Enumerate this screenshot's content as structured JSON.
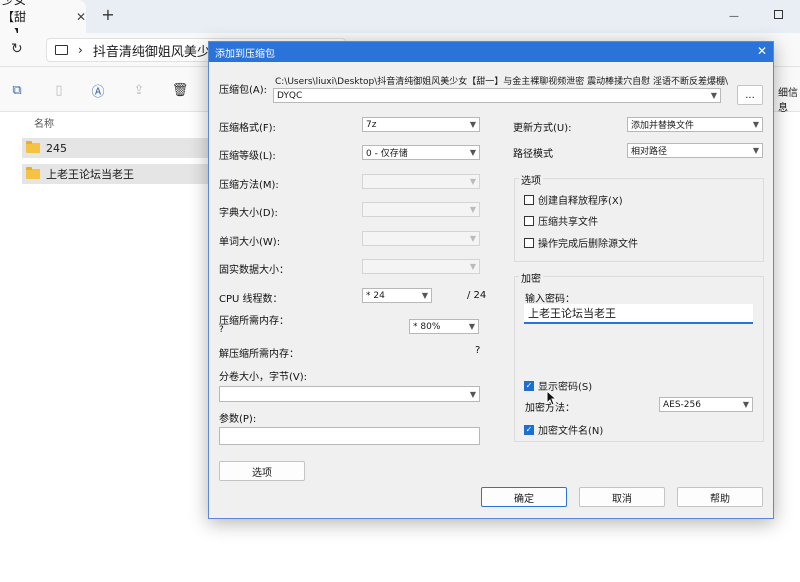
{
  "explorer": {
    "tab_title": "少女【甜一】",
    "path_text": "抖音清纯御姐风美少",
    "column_name": "名称",
    "right_edge_text": "细信息",
    "rows": [
      {
        "name": "245"
      },
      {
        "name": "上老王论坛当老王"
      }
    ]
  },
  "dialog": {
    "title": "添加到压缩包",
    "archive": {
      "label": "压缩包(A):",
      "path": "C:\\Users\\liuxi\\Desktop\\抖音清纯御姐风美少女【甜一】与金主裸聊视频泄密 震动棒揉穴自慰 淫语不断反差爆棚\\",
      "name": "DYQC",
      "browse_label": "..."
    },
    "left": {
      "format_label": "压缩格式(F):",
      "format_value": "7z",
      "level_label": "压缩等级(L):",
      "level_value": "0 - 仅存储",
      "method_label": "压缩方法(M):",
      "dict_label": "字典大小(D):",
      "word_label": "单词大小(W):",
      "solid_label": "固实数据大小：",
      "threads_label": "CPU 线程数：",
      "threads_value": "* 24",
      "threads_total": "/ 24",
      "mem_label": "压缩所需内存：",
      "mem_value": "* 80%",
      "mem_q": "?",
      "decomp_label": "解压缩所需内存：",
      "decomp_q": "?",
      "split_label": "分卷大小，字节(V):",
      "params_label": "参数(P):",
      "options_button": "选项"
    },
    "right": {
      "update_label": "更新方式(U):",
      "update_value": "添加并替换文件",
      "pathmode_label": "路径模式",
      "pathmode_value": "相对路径",
      "options_group": "选项",
      "opt_sfx": "创建自释放程序(X)",
      "opt_shared": "压缩共享文件",
      "opt_delete": "操作完成后删除源文件",
      "enc_group": "加密",
      "pwd_label": "输入密码：",
      "pwd_value": "上老王论坛当老王",
      "show_pwd": "显示密码(S)",
      "enc_method_label": "加密方法：",
      "enc_method_value": "AES-256",
      "enc_names": "加密文件名(N)"
    },
    "buttons": {
      "ok": "确定",
      "cancel": "取消",
      "help": "帮助"
    }
  }
}
